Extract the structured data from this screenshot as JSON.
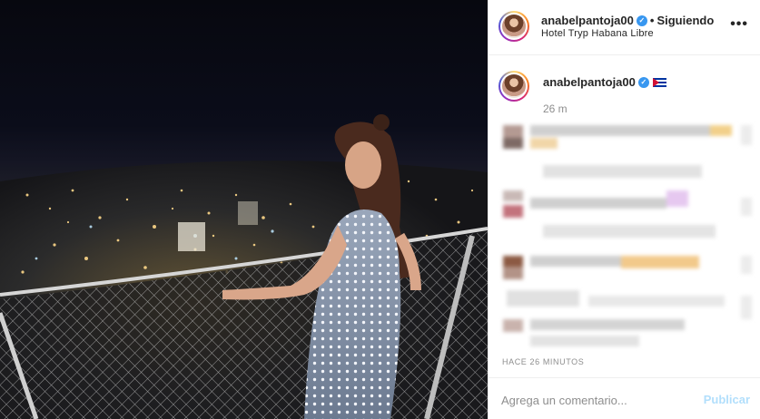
{
  "post": {
    "photo_label": "city-night-photo",
    "author": {
      "username": "anabelpantoja00",
      "verified_icon": "verified-badge-icon",
      "separator": "•",
      "follow_state": "Siguiendo",
      "location": "Hotel Tryp Habana Libre"
    },
    "more_icon": "•••",
    "caption": {
      "username": "anabelpantoja00",
      "flag": "cuba-flag-icon",
      "time_ago": "26 m"
    },
    "timestamp": "HACE 26 MINUTOS",
    "add_comment": {
      "placeholder": "Agrega un comentario...",
      "publish_label": "Publicar"
    }
  },
  "colors": {
    "verified": "#3897f0",
    "publish_disabled": "#b2dffc",
    "muted_text": "#8e8e8e",
    "border": "#efefef"
  }
}
